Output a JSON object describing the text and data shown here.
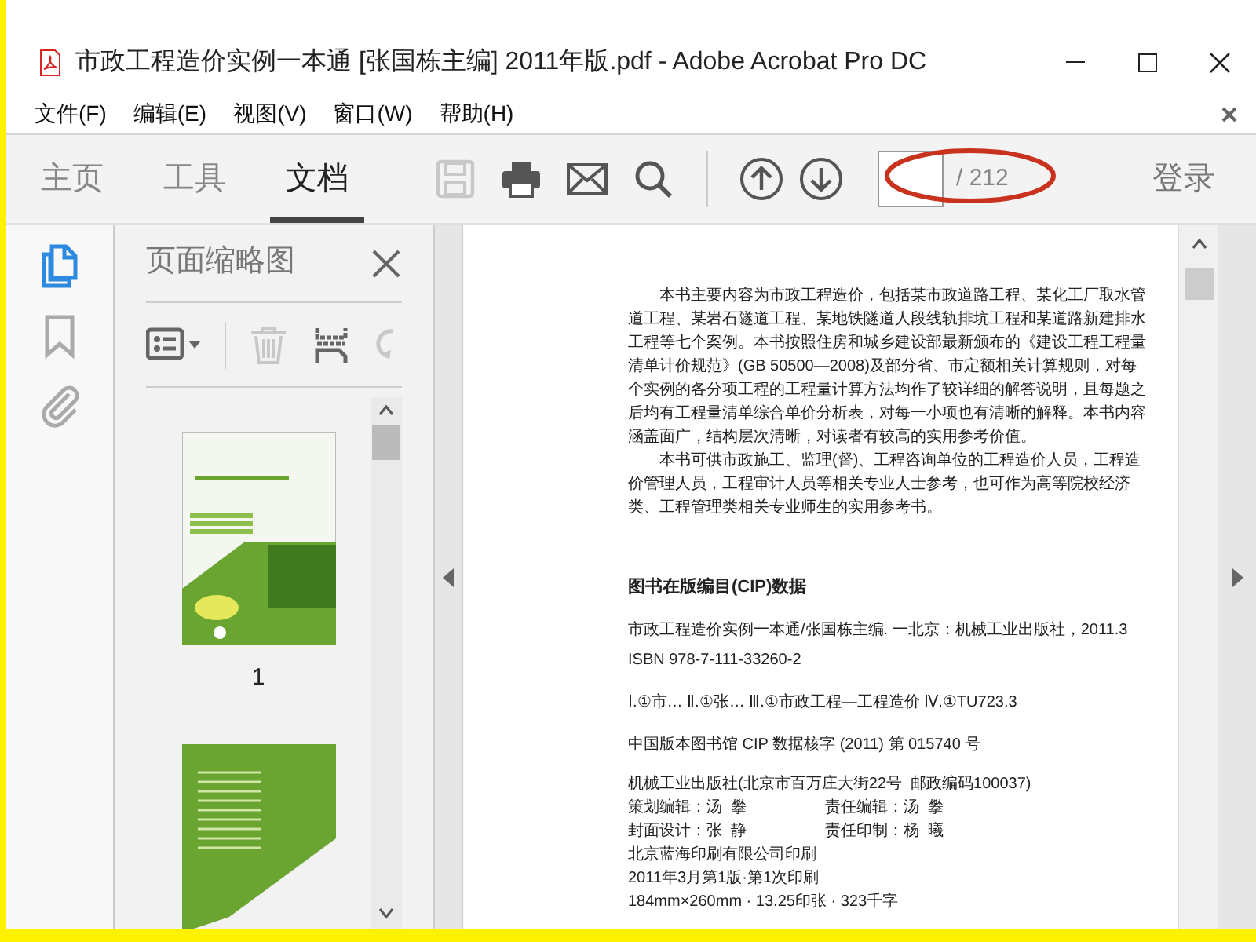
{
  "window": {
    "title": "市政工程造价实例一本通 [张国栋主编] 2011年版.pdf - Adobe Acrobat Pro DC"
  },
  "menu": [
    "文件(F)",
    "编辑(E)",
    "视图(V)",
    "窗口(W)",
    "帮助(H)"
  ],
  "tabs": [
    {
      "label": "主页",
      "selected": false
    },
    {
      "label": "工具",
      "selected": false
    },
    {
      "label": "文档",
      "selected": true
    }
  ],
  "tools": [
    {
      "kind": "save",
      "disabled": true
    },
    {
      "kind": "print",
      "disabled": false
    },
    {
      "kind": "email",
      "disabled": false
    },
    {
      "kind": "search",
      "disabled": false
    }
  ],
  "page_nav": {
    "total": "/ 212"
  },
  "sign_in": "登录",
  "rail": [
    {
      "kind": "pages",
      "selected": true
    },
    {
      "kind": "bookmarks",
      "selected": false
    },
    {
      "kind": "attachments",
      "selected": false
    }
  ],
  "side_panel": {
    "title": "页面缩略图",
    "tools": [
      {
        "kind": "options",
        "disabled": false
      },
      {
        "kind": "delete",
        "disabled": true
      },
      {
        "kind": "extract",
        "disabled": false
      },
      {
        "kind": "rotate",
        "disabled": true
      }
    ],
    "thumbnails": [
      {
        "kind": "cover",
        "label": "1"
      },
      {
        "kind": "page"
      }
    ]
  },
  "document": {
    "paragraphs": [
      "本书主要内容为市政工程造价，包括某市政道路工程、某化工厂取水管道工程、某岩石隧道工程、某地铁隧道人段线轨排坑工程和某道路新建排水工程等七个案例。本书按照住房和城乡建设部最新颁布的《建设工程工程量清单计价规范》(GB 50500—2008)及部分省、市定额相关计算规则，对每个实例的各分项工程的工程量计算方法均作了较详细的解答说明，且每题之后均有工程量清单综合单价分析表，对每一小项也有清晰的解释。本书内容涵盖面广，结构层次清晰，对读者有较高的实用参考价值。",
      "本书可供市政施工、监理(督)、工程咨询单位的工程造价人员，工程造价管理人员，工程审计人员等相关专业人士参考，也可作为高等院校经济类、工程管理类相关专业师生的实用参考书。"
    ],
    "cip_title": "图书在版编目(CIP)数据",
    "cip_lines": [
      "市政工程造价实例一本通/张国栋主编. 一北京：机械工业出版社，2011.3",
      "ISBN 978-7-111-33260-2",
      "Ⅰ.①市…  Ⅱ.①张…  Ⅲ.①市政工程—工程造价  Ⅳ.①TU723.3",
      "中国版本图书馆 CIP 数据核字 (2011) 第 015740 号"
    ],
    "imprint": [
      "机械工业出版社(北京市百万庄大街22号  邮政编码100037)",
      [
        "策划编辑：汤  攀",
        "责任编辑：汤  攀"
      ],
      [
        "封面设计：张  静",
        "责任印制：杨  曦"
      ],
      "北京蓝海印刷有限公司印刷",
      "2011年3月第1版·第1次印刷",
      "184mm×260mm · 13.25印张 · 323千字"
    ]
  }
}
